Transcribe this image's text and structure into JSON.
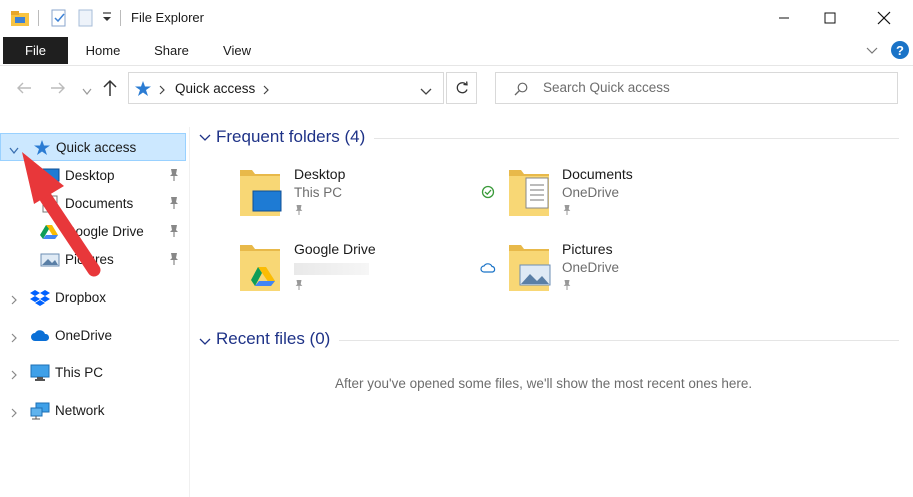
{
  "window": {
    "title": "File Explorer",
    "controls": [
      "minimize",
      "maximize",
      "close"
    ]
  },
  "ribbon": {
    "tabs": [
      "File",
      "Home",
      "Share",
      "View"
    ],
    "active_tab": "File"
  },
  "navigation": {
    "breadcrumb": [
      "Quick access"
    ],
    "search_placeholder": "Search Quick access"
  },
  "sidebar": {
    "items": [
      {
        "label": "Quick access",
        "icon": "star-icon",
        "selected": true,
        "expanded": true
      },
      {
        "label": "Desktop",
        "icon": "desktop-icon",
        "pinned": true
      },
      {
        "label": "Documents",
        "icon": "documents-icon",
        "pinned": true
      },
      {
        "label": "Google Drive",
        "icon": "google-drive-icon",
        "pinned": true
      },
      {
        "label": "Pictures",
        "icon": "pictures-icon",
        "pinned": true
      },
      {
        "label": "Dropbox",
        "icon": "dropbox-icon"
      },
      {
        "label": "OneDrive",
        "icon": "onedrive-icon"
      },
      {
        "label": "This PC",
        "icon": "this-pc-icon"
      },
      {
        "label": "Network",
        "icon": "network-icon"
      }
    ]
  },
  "main": {
    "frequent_header": "Frequent folders (4)",
    "recent_header": "Recent files (0)",
    "empty_message": "After you've opened some files, we'll show the most recent ones here.",
    "folders": [
      {
        "name": "Desktop",
        "location": "This PC",
        "status": "",
        "icon": "desktop-folder-icon"
      },
      {
        "name": "Documents",
        "location": "OneDrive",
        "status": "synced",
        "icon": "documents-folder-icon"
      },
      {
        "name": "Google Drive",
        "location": "",
        "status": "",
        "icon": "google-drive-folder-icon"
      },
      {
        "name": "Pictures",
        "location": "OneDrive",
        "status": "cloud",
        "icon": "pictures-folder-icon"
      }
    ]
  },
  "colors": {
    "accent": "#0078d7",
    "section_header": "#1e3287",
    "selection_bg": "#cce8ff",
    "file_tab_bg": "#1f1f1f",
    "annotation_arrow": "#e8373a",
    "folder_yellow": "#f8d775"
  }
}
